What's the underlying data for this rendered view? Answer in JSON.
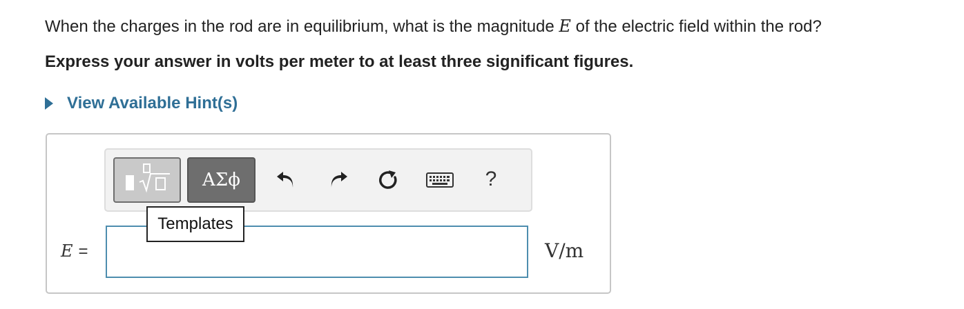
{
  "question": {
    "before": "When the charges in the rod are in equilibrium, what is the magnitude ",
    "variable": "E",
    "after": " of the electric field within the rod?"
  },
  "instruction": "Express your answer in volts per meter to at least three significant figures.",
  "hint_link": "View Available Hint(s)",
  "toolbar": {
    "symbols_label": "ΑΣϕ",
    "help_label": "?",
    "tooltip": "Templates",
    "icons": [
      "templates-icon",
      "undo-icon",
      "redo-icon",
      "reset-icon",
      "keyboard-icon",
      "help-icon"
    ]
  },
  "answer": {
    "variable": "E",
    "equals": "=",
    "value": "",
    "units": "V/m"
  },
  "colors": {
    "link": "#2f6f96",
    "input_border": "#4d8dae",
    "symbols_button": "#6e6e6e",
    "templates_button": "#c9c9c9"
  }
}
